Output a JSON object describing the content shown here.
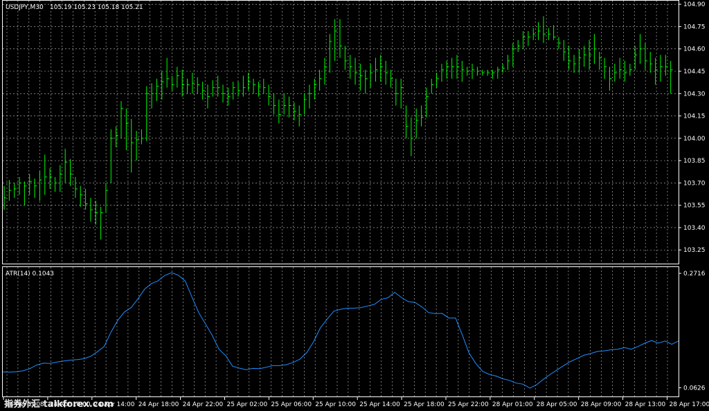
{
  "header": {
    "symbol": "USDJPY,M30",
    "ohlc": "105.19 105.23 105.18 105.21"
  },
  "indicator": {
    "label": "ATR(14) 0.1043"
  },
  "watermark": "指券外汇 talkforex.com",
  "colors": {
    "background": "#000000",
    "grid": "#c8c8c8",
    "frame": "#ffffff",
    "price_bars": "#00ff00",
    "atr_line": "#1e90ff",
    "text": "#ffffff"
  },
  "chart_data": [
    {
      "type": "ohlc",
      "title": "USDJPY,M30",
      "y_ticks": [
        "104.90",
        "104.75",
        "104.60",
        "104.45",
        "104.30",
        "104.15",
        "104.00",
        "103.85",
        "103.70",
        "103.55",
        "103.40",
        "103.25"
      ],
      "ylim": [
        103.2,
        104.91
      ],
      "grid": true,
      "bars": [
        {
          "h": 103.68,
          "l": 103.52,
          "c": 103.6
        },
        {
          "h": 103.72,
          "l": 103.58,
          "c": 103.65
        },
        {
          "h": 103.7,
          "l": 103.6,
          "c": 103.66
        },
        {
          "h": 103.74,
          "l": 103.62,
          "c": 103.7
        },
        {
          "h": 103.71,
          "l": 103.55,
          "c": 103.68
        },
        {
          "h": 103.76,
          "l": 103.62,
          "c": 103.71
        },
        {
          "h": 103.73,
          "l": 103.6,
          "c": 103.68
        },
        {
          "h": 103.78,
          "l": 103.58,
          "c": 103.72
        },
        {
          "h": 103.89,
          "l": 103.62,
          "c": 103.74
        },
        {
          "h": 103.8,
          "l": 103.66,
          "c": 103.74
        },
        {
          "h": 103.74,
          "l": 103.64,
          "c": 103.7
        },
        {
          "h": 103.82,
          "l": 103.64,
          "c": 103.76
        },
        {
          "h": 103.93,
          "l": 103.7,
          "c": 103.84
        },
        {
          "h": 103.86,
          "l": 103.68,
          "c": 103.76
        },
        {
          "h": 103.74,
          "l": 103.6,
          "c": 103.66
        },
        {
          "h": 103.68,
          "l": 103.54,
          "c": 103.62
        },
        {
          "h": 103.66,
          "l": 103.52,
          "c": 103.56
        },
        {
          "h": 103.6,
          "l": 103.44,
          "c": 103.52
        },
        {
          "h": 103.58,
          "l": 103.42,
          "c": 103.5
        },
        {
          "h": 103.54,
          "l": 103.32,
          "c": 103.5
        },
        {
          "h": 103.7,
          "l": 103.5,
          "c": 103.65
        },
        {
          "h": 104.06,
          "l": 103.7,
          "c": 104.0
        },
        {
          "h": 104.08,
          "l": 103.94,
          "c": 104.02
        },
        {
          "h": 104.25,
          "l": 104.0,
          "c": 104.2
        },
        {
          "h": 104.2,
          "l": 103.92,
          "c": 104.1
        },
        {
          "h": 104.13,
          "l": 103.77,
          "c": 103.97
        },
        {
          "h": 104.05,
          "l": 103.85,
          "c": 103.99
        },
        {
          "h": 104.06,
          "l": 103.96,
          "c": 104.0
        },
        {
          "h": 104.35,
          "l": 103.98,
          "c": 104.3
        },
        {
          "h": 104.37,
          "l": 104.2,
          "c": 104.3
        },
        {
          "h": 104.4,
          "l": 104.25,
          "c": 104.35
        },
        {
          "h": 104.45,
          "l": 104.26,
          "c": 104.38
        },
        {
          "h": 104.54,
          "l": 104.34,
          "c": 104.4
        },
        {
          "h": 104.42,
          "l": 104.32,
          "c": 104.36
        },
        {
          "h": 104.48,
          "l": 104.34,
          "c": 104.42
        },
        {
          "h": 104.46,
          "l": 104.28,
          "c": 104.36
        },
        {
          "h": 104.4,
          "l": 104.3,
          "c": 104.36
        },
        {
          "h": 104.44,
          "l": 104.3,
          "c": 104.37
        },
        {
          "h": 104.41,
          "l": 104.3,
          "c": 104.36
        },
        {
          "h": 104.38,
          "l": 104.26,
          "c": 104.32
        },
        {
          "h": 104.36,
          "l": 104.2,
          "c": 104.28
        },
        {
          "h": 104.39,
          "l": 104.28,
          "c": 104.34
        },
        {
          "h": 104.42,
          "l": 104.28,
          "c": 104.34
        },
        {
          "h": 104.36,
          "l": 104.24,
          "c": 104.3
        },
        {
          "h": 104.34,
          "l": 104.22,
          "c": 104.28
        },
        {
          "h": 104.38,
          "l": 104.26,
          "c": 104.34
        },
        {
          "h": 104.38,
          "l": 104.28,
          "c": 104.32
        },
        {
          "h": 104.42,
          "l": 104.28,
          "c": 104.34
        },
        {
          "h": 104.44,
          "l": 104.32,
          "c": 104.38
        },
        {
          "h": 104.4,
          "l": 104.3,
          "c": 104.36
        },
        {
          "h": 104.38,
          "l": 104.28,
          "c": 104.35
        },
        {
          "h": 104.4,
          "l": 104.3,
          "c": 104.34
        },
        {
          "h": 104.36,
          "l": 104.22,
          "c": 104.28
        },
        {
          "h": 104.3,
          "l": 104.16,
          "c": 104.22
        },
        {
          "h": 104.26,
          "l": 104.1,
          "c": 104.16
        },
        {
          "h": 104.3,
          "l": 104.16,
          "c": 104.22
        },
        {
          "h": 104.28,
          "l": 104.14,
          "c": 104.22
        },
        {
          "h": 104.24,
          "l": 104.12,
          "c": 104.18
        },
        {
          "h": 104.22,
          "l": 104.08,
          "c": 104.16
        },
        {
          "h": 104.3,
          "l": 104.16,
          "c": 104.26
        },
        {
          "h": 104.36,
          "l": 104.2,
          "c": 104.3
        },
        {
          "h": 104.4,
          "l": 104.26,
          "c": 104.36
        },
        {
          "h": 104.46,
          "l": 104.32,
          "c": 104.4
        },
        {
          "h": 104.54,
          "l": 104.36,
          "c": 104.48
        },
        {
          "h": 104.7,
          "l": 104.44,
          "c": 104.65
        },
        {
          "h": 104.8,
          "l": 104.52,
          "c": 104.72
        },
        {
          "h": 104.8,
          "l": 104.54,
          "c": 104.62
        },
        {
          "h": 104.62,
          "l": 104.46,
          "c": 104.52
        },
        {
          "h": 104.56,
          "l": 104.4,
          "c": 104.48
        },
        {
          "h": 104.54,
          "l": 104.36,
          "c": 104.44
        },
        {
          "h": 104.5,
          "l": 104.32,
          "c": 104.42
        },
        {
          "h": 104.46,
          "l": 104.3,
          "c": 104.4
        },
        {
          "h": 104.5,
          "l": 104.34,
          "c": 104.44
        },
        {
          "h": 104.54,
          "l": 104.38,
          "c": 104.46
        },
        {
          "h": 104.56,
          "l": 104.38,
          "c": 104.48
        },
        {
          "h": 104.52,
          "l": 104.36,
          "c": 104.44
        },
        {
          "h": 104.46,
          "l": 104.34,
          "c": 104.4
        },
        {
          "h": 104.4,
          "l": 104.22,
          "c": 104.3
        },
        {
          "h": 104.4,
          "l": 104.2,
          "c": 104.34
        },
        {
          "h": 104.22,
          "l": 104.0,
          "c": 104.08
        },
        {
          "h": 104.14,
          "l": 103.88,
          "c": 104.0
        },
        {
          "h": 104.2,
          "l": 104.0,
          "c": 104.12
        },
        {
          "h": 104.22,
          "l": 104.08,
          "c": 104.14
        },
        {
          "h": 104.34,
          "l": 104.14,
          "c": 104.28
        },
        {
          "h": 104.4,
          "l": 104.3,
          "c": 104.36
        },
        {
          "h": 104.44,
          "l": 104.34,
          "c": 104.4
        },
        {
          "h": 104.5,
          "l": 104.38,
          "c": 104.46
        },
        {
          "h": 104.52,
          "l": 104.4,
          "c": 104.48
        },
        {
          "h": 104.54,
          "l": 104.4,
          "c": 104.48
        },
        {
          "h": 104.56,
          "l": 104.4,
          "c": 104.48
        },
        {
          "h": 104.52,
          "l": 104.38,
          "c": 104.46
        },
        {
          "h": 104.48,
          "l": 104.42,
          "c": 104.45
        },
        {
          "h": 104.5,
          "l": 104.4,
          "c": 104.46
        },
        {
          "h": 104.48,
          "l": 104.42,
          "c": 104.45
        },
        {
          "h": 104.46,
          "l": 104.42,
          "c": 104.44
        },
        {
          "h": 104.46,
          "l": 104.42,
          "c": 104.44
        },
        {
          "h": 104.46,
          "l": 104.4,
          "c": 104.44
        },
        {
          "h": 104.48,
          "l": 104.4,
          "c": 104.46
        },
        {
          "h": 104.5,
          "l": 104.44,
          "c": 104.47
        },
        {
          "h": 104.56,
          "l": 104.46,
          "c": 104.52
        },
        {
          "h": 104.64,
          "l": 104.48,
          "c": 104.6
        },
        {
          "h": 104.66,
          "l": 104.58,
          "c": 104.62
        },
        {
          "h": 104.72,
          "l": 104.6,
          "c": 104.68
        },
        {
          "h": 104.72,
          "l": 104.62,
          "c": 104.68
        },
        {
          "h": 104.74,
          "l": 104.66,
          "c": 104.7
        },
        {
          "h": 104.78,
          "l": 104.66,
          "c": 104.72
        },
        {
          "h": 104.82,
          "l": 104.64,
          "c": 104.7
        },
        {
          "h": 104.74,
          "l": 104.66,
          "c": 104.7
        },
        {
          "h": 104.76,
          "l": 104.66,
          "c": 104.68
        },
        {
          "h": 104.68,
          "l": 104.6,
          "c": 104.64
        },
        {
          "h": 104.66,
          "l": 104.52,
          "c": 104.58
        },
        {
          "h": 104.62,
          "l": 104.46,
          "c": 104.52
        },
        {
          "h": 104.56,
          "l": 104.44,
          "c": 104.5
        },
        {
          "h": 104.6,
          "l": 104.44,
          "c": 104.54
        },
        {
          "h": 104.62,
          "l": 104.48,
          "c": 104.56
        },
        {
          "h": 104.66,
          "l": 104.46,
          "c": 104.56
        },
        {
          "h": 104.7,
          "l": 104.5,
          "c": 104.6
        },
        {
          "h": 104.58,
          "l": 104.46,
          "c": 104.54
        },
        {
          "h": 104.54,
          "l": 104.4,
          "c": 104.48
        },
        {
          "h": 104.48,
          "l": 104.32,
          "c": 104.4
        },
        {
          "h": 104.5,
          "l": 104.38,
          "c": 104.44
        },
        {
          "h": 104.54,
          "l": 104.4,
          "c": 104.46
        },
        {
          "h": 104.52,
          "l": 104.38,
          "c": 104.44
        },
        {
          "h": 104.5,
          "l": 104.42,
          "c": 104.46
        },
        {
          "h": 104.62,
          "l": 104.46,
          "c": 104.56
        },
        {
          "h": 104.7,
          "l": 104.5,
          "c": 104.6
        },
        {
          "h": 104.64,
          "l": 104.46,
          "c": 104.52
        },
        {
          "h": 104.58,
          "l": 104.44,
          "c": 104.5
        },
        {
          "h": 104.54,
          "l": 104.36,
          "c": 104.46
        },
        {
          "h": 104.56,
          "l": 104.38,
          "c": 104.48
        },
        {
          "h": 104.56,
          "l": 104.42,
          "c": 104.48
        },
        {
          "h": 104.52,
          "l": 104.3,
          "c": 104.46
        }
      ]
    },
    {
      "type": "line",
      "title": "ATR(14) 0.1043",
      "series": [
        {
          "values": [
            0.0915,
            0.091,
            0.0918,
            0.0935,
            0.0975,
            0.104,
            0.1075,
            0.107,
            0.1095,
            0.1115,
            0.113,
            0.114,
            0.1155,
            0.12,
            0.1285,
            0.138,
            0.164,
            0.1855,
            0.201,
            0.209,
            0.225,
            0.243,
            0.253,
            0.258,
            0.268,
            0.2729,
            0.268,
            0.2575,
            0.228,
            0.2,
            0.179,
            0.158,
            0.133,
            0.121,
            0.102,
            0.0985,
            0.0955,
            0.098,
            0.0975,
            0.1,
            0.103,
            0.103,
            0.1048,
            0.109,
            0.115,
            0.127,
            0.147,
            0.172,
            0.188,
            0.2025,
            0.206,
            0.208,
            0.208,
            0.209,
            0.212,
            0.215,
            0.224,
            0.227,
            0.237,
            0.2275,
            0.22,
            0.2185,
            0.2105,
            0.2,
            0.198,
            0.1985,
            0.19,
            0.19,
            0.159,
            0.126,
            0.107,
            0.0925,
            0.087,
            0.084,
            0.079,
            0.076,
            0.071,
            0.069,
            0.062,
            0.068,
            0.078,
            0.087,
            0.095,
            0.103,
            0.1105,
            0.116,
            0.122,
            0.125,
            0.129,
            0.13,
            0.132,
            0.133,
            0.136,
            0.133,
            0.138,
            0.144,
            0.149,
            0.144,
            0.148,
            0.142,
            0.148
          ]
        }
      ],
      "y_ticks": [
        "0.2716",
        "0.0626"
      ],
      "ylim": [
        0.0555,
        0.2755
      ],
      "grid": true
    }
  ],
  "x_ticks": [
    "24 Apr 2008",
    "24 Apr 10:00",
    "24 Apr 14:00",
    "24 Apr 18:00",
    "24 Apr 22:00",
    "25 Apr 02:00",
    "25 Apr 06:00",
    "25 Apr 10:00",
    "25 Apr 14:00",
    "25 Apr 18:00",
    "25 Apr 22:00",
    "28 Apr 01:00",
    "28 Apr 05:00",
    "28 Apr 09:00",
    "28 Apr 13:00",
    "28 Apr 17:00"
  ]
}
